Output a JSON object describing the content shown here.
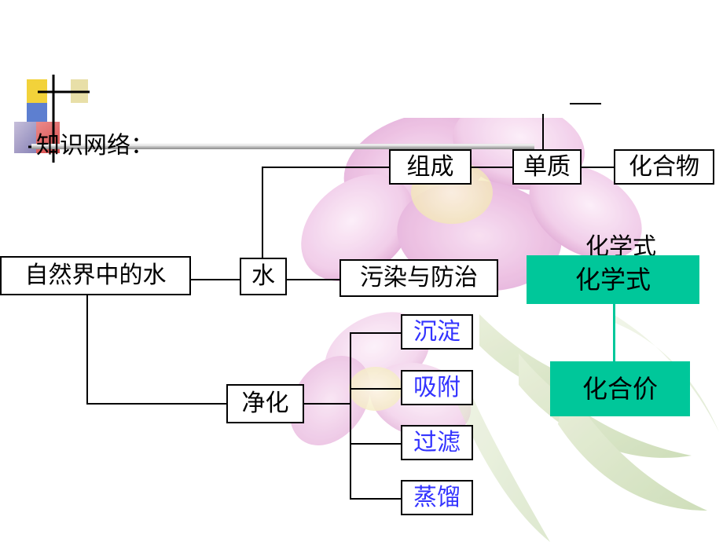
{
  "slide": {
    "title": "知识网络：",
    "logo_name": "powerpoint-design-logo",
    "background_image_name": "flower-watermark"
  },
  "nodes": {
    "nature_water": "自然界中的水",
    "water": "水",
    "composition": "组成",
    "element": "单质",
    "compound": "化合物",
    "pollution": "污染与防治",
    "chemical_formula_ghost": "化学式",
    "chemical_formula": "化学式",
    "valence": "化合价",
    "purification": "净化",
    "precipitate": "沉淀",
    "adsorb": "吸附",
    "filter": "过滤",
    "distill": "蒸馏"
  },
  "colors": {
    "green_fill": "#00c79a",
    "blue_text": "#3333ff",
    "border": "#000000",
    "title_bar": "#8a8a8a"
  }
}
